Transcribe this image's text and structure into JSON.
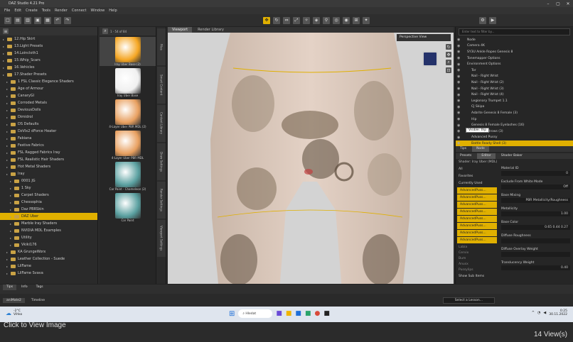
{
  "window": {
    "title": "DAZ Studio 4.21 Pro"
  },
  "menu": [
    "File",
    "Edit",
    "Create",
    "Tools",
    "Render",
    "Connect",
    "Window",
    "Help"
  ],
  "left_tree": [
    {
      "label": "12.Hip Skirt",
      "indent": 1
    },
    {
      "label": "13.Light Presets",
      "indent": 1
    },
    {
      "label": "14.Loincloth1",
      "indent": 1
    },
    {
      "label": "15.Whip_Scars",
      "indent": 1
    },
    {
      "label": "16.Vehicles",
      "indent": 1
    },
    {
      "label": "17.Shader Presets",
      "indent": 1
    },
    {
      "label": "1 FSL Classic Elegance Shaders",
      "indent": 2
    },
    {
      "label": "Age of Armour",
      "indent": 2
    },
    {
      "label": "CanaryGl",
      "indent": 2
    },
    {
      "label": "Corroded Metals",
      "indent": 2
    },
    {
      "label": "DeviousDolls",
      "indent": 2
    },
    {
      "label": "Dimidrol",
      "indent": 2
    },
    {
      "label": "DS Defaults",
      "indent": 2
    },
    {
      "label": "DzVlx2 dForce Heater",
      "indent": 2
    },
    {
      "label": "Fabiana",
      "indent": 2
    },
    {
      "label": "Festive Fabrics",
      "indent": 2
    },
    {
      "label": "FSL Ragged Fabrics Iray",
      "indent": 2
    },
    {
      "label": "FSL Realistic Hair Shaders",
      "indent": 2
    },
    {
      "label": "Hot Metal Shaders",
      "indent": 2
    },
    {
      "label": "Iray",
      "indent": 2
    },
    {
      "label": "0001 JG",
      "indent": 3
    },
    {
      "label": "1 Sky",
      "indent": 3
    },
    {
      "label": "Carpet Shaders",
      "indent": 3
    },
    {
      "label": "Chessophia",
      "indent": 3
    },
    {
      "label": "Daz PBRSkin",
      "indent": 3
    },
    {
      "label": "DAZ Uber",
      "indent": 3,
      "selected": true
    },
    {
      "label": "Marble Iray Shaders",
      "indent": 3
    },
    {
      "label": "NVIDIA MDL Examples",
      "indent": 3
    },
    {
      "label": "Utility",
      "indent": 3
    },
    {
      "label": "Vkiki176",
      "indent": 3
    },
    {
      "label": "KA GrungeWorx",
      "indent": 2
    },
    {
      "label": "Leather Collection - Suede",
      "indent": 2
    },
    {
      "label": "LilFame",
      "indent": 2
    },
    {
      "label": "LilFame Svava",
      "indent": 2
    }
  ],
  "left_bottom_tabs": [
    "Tips",
    "Info",
    "Tags"
  ],
  "mid_header": "1 - 54 of 84",
  "mid_items": [
    {
      "label": "Iray Uber Base (2)",
      "color": "#f5a623",
      "selected": true
    },
    {
      "label": "Iray Uber Base",
      "color": "#f0f0f0"
    },
    {
      "label": "4-Layer Uber PBR MDL (2)",
      "color": "#e8a060"
    },
    {
      "label": "4-Layer Uber PBR MDL",
      "color": "#e8a060"
    },
    {
      "label": "Car Paint - Chameleon (2)",
      "color": "#5aa0a0"
    },
    {
      "label": "Car Paint",
      "color": "#5aa0a0"
    }
  ],
  "vertical_tabs": [
    "Files",
    "Smart Content",
    "Content Library",
    "Draw Settings",
    "Render Settings",
    "Viewport Settings"
  ],
  "viewport": {
    "tabs": [
      "Viewport",
      "Render Library"
    ],
    "view_name": "Perspective View"
  },
  "scene_search_placeholder": "Enter text to filter by...",
  "scene_rows": [
    {
      "label": "Node",
      "selected": false
    },
    {
      "label": "Camera 4K",
      "selected": false
    },
    {
      "label": "SY3U Ankle Ropes Genesis 8",
      "selected": false
    },
    {
      "label": "Tonemapper Options",
      "selected": false
    },
    {
      "label": "Environment Options",
      "selected": false
    },
    {
      "label": "Tor",
      "selected": false
    },
    {
      "label": "Nail - Right Wrist",
      "selected": false
    },
    {
      "label": "Nail - Right Wrist (2)",
      "selected": false
    },
    {
      "label": "Nail - Right Wrist (3)",
      "selected": false
    },
    {
      "label": "Nail - Right Wrist (4)",
      "selected": false
    },
    {
      "label": "Legionary Trumpet 1.1",
      "selected": false
    },
    {
      "label": "CJ Skipa",
      "selected": false
    },
    {
      "label": "Asbrite Genesis 8 Female (3)",
      "selected": false
    },
    {
      "label": "Hip",
      "selected": false
    },
    {
      "label": "Genesis 8 Female Eyelashes (16)",
      "selected": false
    },
    {
      "label": "CJ Asbrite Brows (3)",
      "selected": false
    },
    {
      "label": "Advanced Pussy",
      "selected": false
    },
    {
      "label": "Battle Ready Shell (3)",
      "selected": true
    },
    {
      "label": "Tree-01-1",
      "selected": false
    }
  ],
  "visible_tooltip": "Visible: thp",
  "scene_tabs": [
    "Tips",
    "Node"
  ],
  "surface_tabs": [
    "Presets",
    "Editor",
    "Shader Baker"
  ],
  "shader_label": "Shader: Iray Uber (MDL)",
  "surface_filters": [
    "All",
    "Favorites",
    "Currently Used"
  ],
  "surface_groups": [
    "AdvancedPuss...",
    "AdvancedPuss...",
    "AdvancedPuss...",
    "AdvancedPuss...",
    "AdvancedPuss...",
    "AdvancedPuss...",
    "AdvancedPuss...",
    "AdvancedPuss..."
  ],
  "surface_items": [
    "Labia",
    "Cervix",
    "Bum",
    "Anusx",
    "Pussylips"
  ],
  "properties": [
    {
      "label": "Material ID",
      "value": "0"
    },
    {
      "label": "Exclude From White Mode",
      "value": "Off"
    },
    {
      "label": "Base Mixing",
      "value": "PBR Metallicity/Roughness"
    },
    {
      "label": "Metallicity",
      "value": "1.00"
    },
    {
      "label": "Base Color",
      "value": "0.65   0.44   0.27"
    },
    {
      "label": "Diffuse Roughness",
      "value": ""
    },
    {
      "label": "Diffuse Overlay Weight",
      "value": ""
    },
    {
      "label": "Translucency Weight",
      "value": "0.40"
    }
  ],
  "show_sub_items": "Show Sub Items",
  "bottom_tabs": [
    "aniMate2",
    "Timeline"
  ],
  "select_lesson": "Select a Lesson...",
  "taskbar": {
    "temp": "-2°C",
    "weather": "Vihko",
    "search": "Hledat",
    "time": "0:25",
    "date": "30.11.2022"
  },
  "caption": "Click to View Image",
  "views": "14 View(s)",
  "colors": {
    "accent": "#e0b000",
    "bg": "#2b2b2b"
  }
}
